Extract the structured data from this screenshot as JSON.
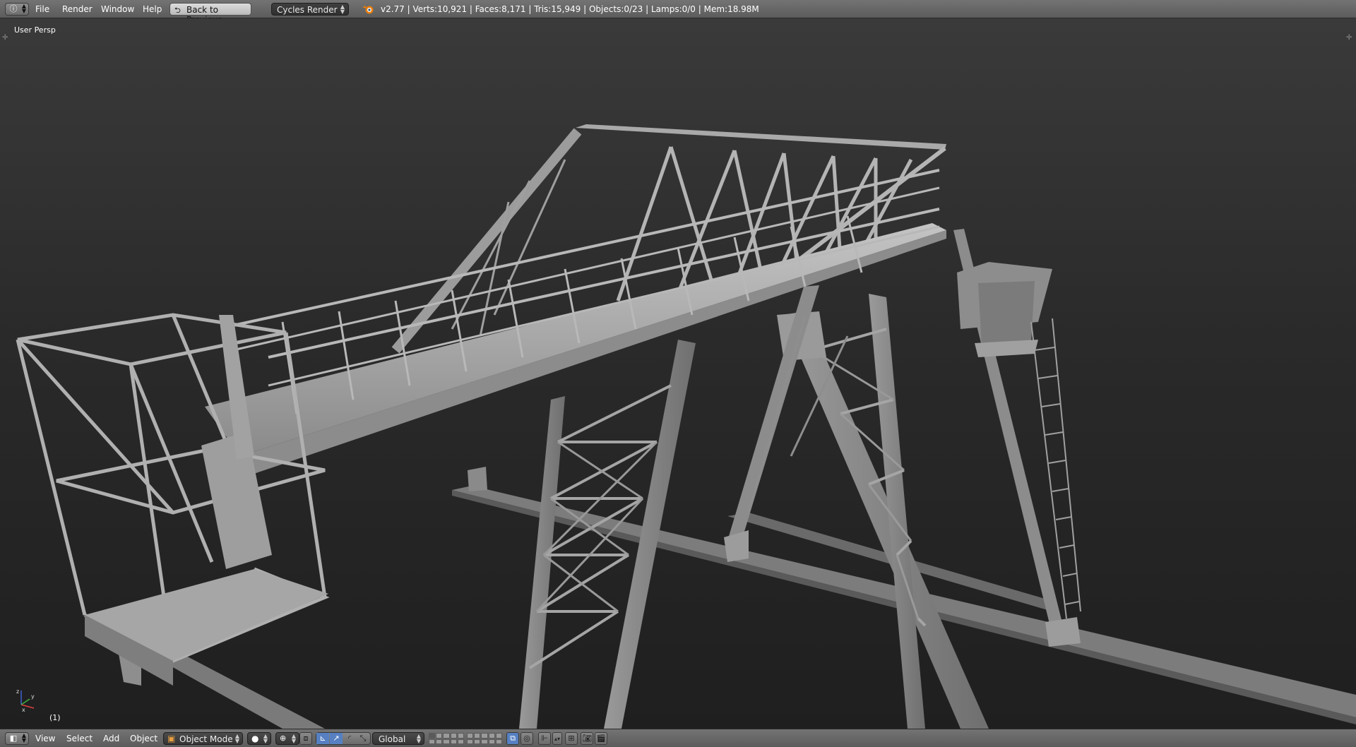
{
  "top_header": {
    "editor_type_icon": "info-icon",
    "menus": [
      "File",
      "Render",
      "Window",
      "Help"
    ],
    "back_button": "Back to Previous",
    "render_engine": "Cycles Render",
    "stats": "v2.77 | Verts:10,921 | Faces:8,171 | Tris:15,949 | Objects:0/23 | Lamps:0/0 | Mem:18.98M"
  },
  "viewport": {
    "view_label": "User Persp",
    "frame_label": "(1)",
    "colors": {
      "background_top": "#3a3a3a",
      "background_bottom": "#1f1f1f",
      "model": "#a8a8a8"
    }
  },
  "bottom_header": {
    "editor_type_icon": "3d-view-icon",
    "menus": [
      "View",
      "Select",
      "Add",
      "Object"
    ],
    "mode": "Object Mode",
    "shading_icon": "solid-shading-icon",
    "pivot_icon": "pivot-point-icon",
    "orientation": "Global",
    "accent_color": "#5680c2"
  }
}
